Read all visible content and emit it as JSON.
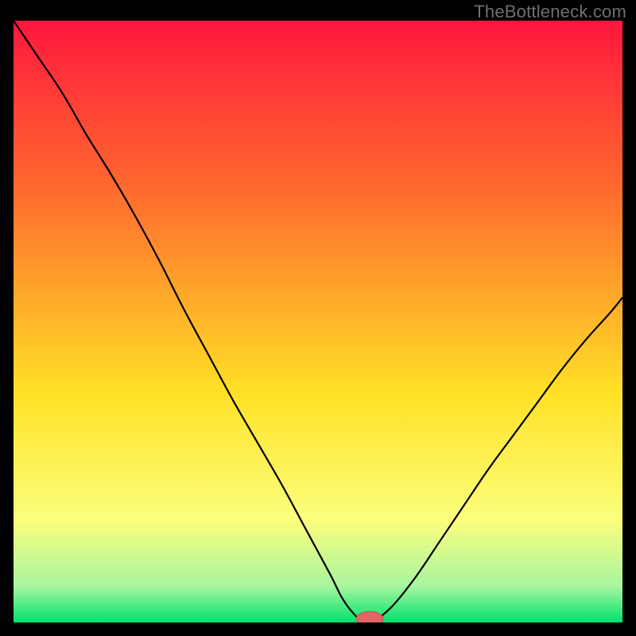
{
  "watermark": "TheBottleneck.com",
  "colors": {
    "bg": "#000000",
    "grad_top": "#ff173e",
    "grad_upper": "#ff6a2e",
    "grad_mid": "#ffe126",
    "grad_low1": "#fbff7d",
    "grad_low2": "#a8f59f",
    "grad_bottom": "#00e36e",
    "curve": "#000000",
    "marker_fill": "#e06666",
    "marker_stroke": "#cc5252"
  },
  "chart_data": {
    "type": "line",
    "title": "",
    "xlabel": "",
    "ylabel": "",
    "xrange": [
      0,
      100
    ],
    "ylim": [
      0,
      100
    ],
    "x": [
      0,
      4,
      8,
      12,
      16,
      20,
      24,
      28,
      32,
      36,
      40,
      44,
      48,
      52,
      54,
      56,
      57.5,
      59,
      62,
      66,
      70,
      74,
      78,
      82,
      86,
      90,
      94,
      98,
      100
    ],
    "values": [
      100,
      94,
      88,
      81,
      74.5,
      67.5,
      60,
      52,
      44.5,
      37,
      30,
      23,
      15.5,
      8,
      4,
      1.3,
      0.2,
      0.2,
      2.5,
      7.5,
      13.5,
      19.5,
      25.5,
      31,
      36.5,
      42,
      47,
      51.5,
      54
    ],
    "flat_min": {
      "x_start": 55.5,
      "x_end": 60.5,
      "y": 0.2
    },
    "marker": {
      "x": 58.5,
      "y": 0.6,
      "rx": 2.2,
      "ry": 1.2
    }
  }
}
